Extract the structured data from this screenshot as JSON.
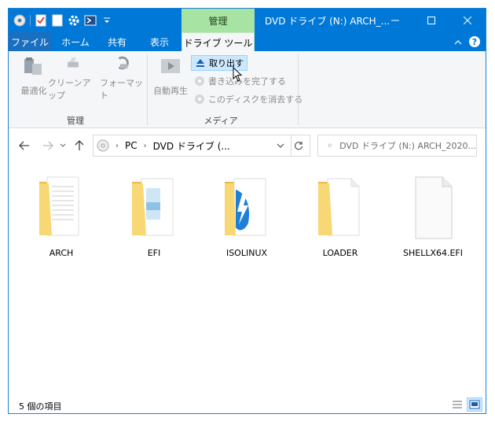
{
  "titlebar": {
    "qat_icons": [
      "disc-icon",
      "properties-icon",
      "new-folder-icon",
      "gear-icon",
      "powershell-icon",
      "customize-dropdown-icon"
    ],
    "context_tab_header": "管理",
    "title": "DVD ドライブ (N:) ARCH_..."
  },
  "tabs": [
    "ファイル",
    "ホーム",
    "共有",
    "表示",
    "ドライブ ツール"
  ],
  "ribbon": {
    "manage_group": {
      "label": "管理",
      "buttons": [
        "最適化",
        "クリーンアップ",
        "フォーマット"
      ]
    },
    "media_group": {
      "label": "メディア",
      "autoplay": "自動再生",
      "eject": "取り出す",
      "finish_burning": "書き込みを完了する",
      "erase_disc": "このディスクを消去する"
    }
  },
  "nav": {
    "path": [
      "PC",
      "DVD ドライブ (..."
    ],
    "search_placeholder": "DVD ドライブ (N:) ARCH_2020..."
  },
  "files": [
    {
      "name": "ARCH",
      "kind": "folder-document"
    },
    {
      "name": "EFI",
      "kind": "folder-image"
    },
    {
      "name": "ISOLINUX",
      "kind": "folder-app"
    },
    {
      "name": "LOADER",
      "kind": "folder-blank"
    },
    {
      "name": "SHELLX64.EFI",
      "kind": "file"
    }
  ],
  "status": {
    "item_count": "5 個の項目"
  },
  "colors": {
    "titlebar": "#0078d7",
    "context_tab": "#a7e3a2",
    "folder": "#f8d775",
    "selection": "#cce8ff"
  }
}
